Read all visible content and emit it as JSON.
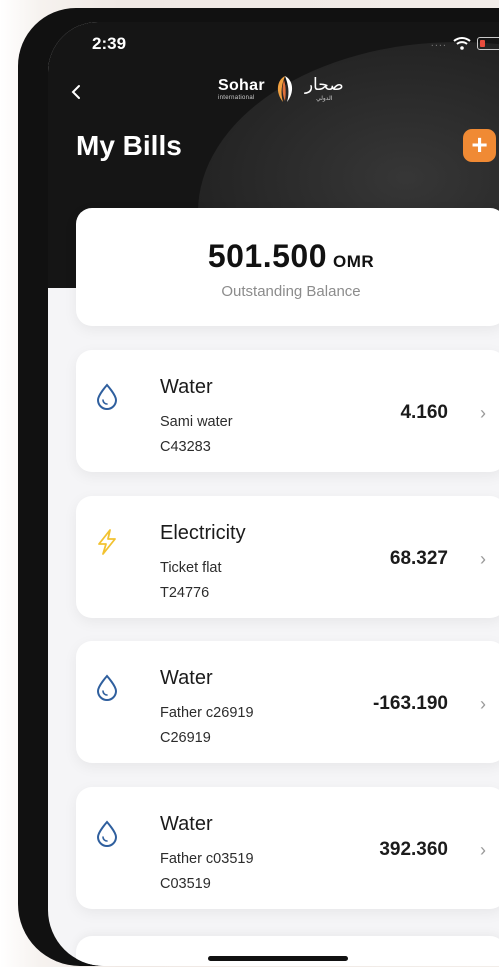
{
  "status_bar": {
    "time": "2:39",
    "signal": "...."
  },
  "header": {
    "back_icon": "chevron-left-icon",
    "logo": {
      "en": "Sohar",
      "en_sub": "international",
      "ar": "صحار",
      "ar_sub": "الدولي"
    },
    "title": "My Bills",
    "add_label": "+"
  },
  "balance": {
    "amount": "501.500",
    "currency": "OMR",
    "label": "Outstanding Balance"
  },
  "bills": [
    {
      "icon": "water-drop-icon",
      "type": "Water",
      "name": "Sami water",
      "account": "C43283",
      "amount": "4.160"
    },
    {
      "icon": "lightning-icon",
      "type": "Electricity",
      "name": "Ticket flat",
      "account": "T24776",
      "amount": "68.327"
    },
    {
      "icon": "water-drop-icon",
      "type": "Water",
      "name": "Father c26919",
      "account": "C26919",
      "amount": "-163.190"
    },
    {
      "icon": "water-drop-icon",
      "type": "Water",
      "name": "Father c03519",
      "account": "C03519",
      "amount": "392.360"
    }
  ],
  "chevron": "›",
  "colors": {
    "accent": "#f08a34",
    "water_icon": "#2f5f9e",
    "electricity_icon": "#f2c230",
    "header_bg": "#151515"
  }
}
